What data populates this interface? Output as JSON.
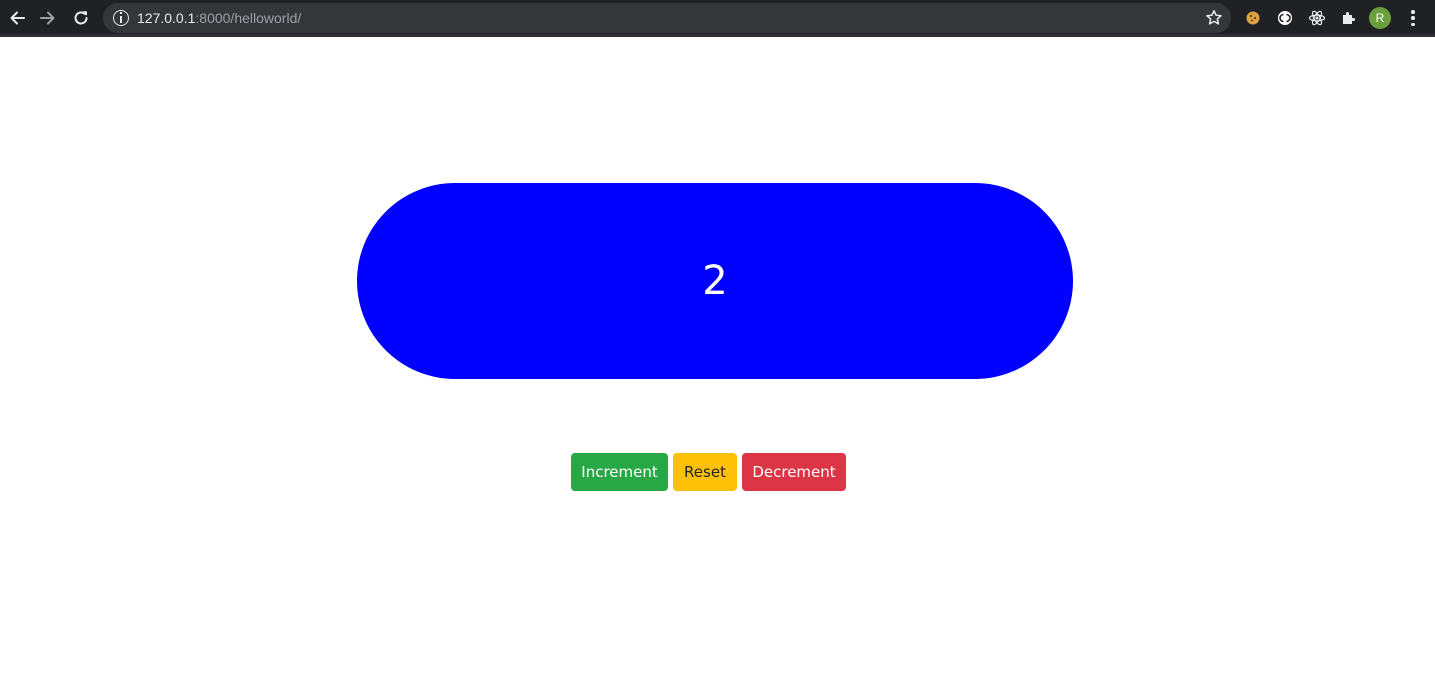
{
  "browser": {
    "url_host": "127.0.0.1",
    "url_rest": ":8000/helloworld/",
    "avatar_letter": "R",
    "icons": [
      "back-icon",
      "forward-icon",
      "reload-icon",
      "info-icon",
      "star-icon",
      "cookie-extension-icon",
      "extension-icon",
      "react-devtools-icon",
      "puzzle-extensions-icon",
      "avatar",
      "menu-icon"
    ]
  },
  "counter": {
    "value": "2",
    "background_color": "#0000ff"
  },
  "buttons": {
    "increment_label": "Increment",
    "reset_label": "Reset",
    "decrement_label": "Decrement",
    "colors": {
      "increment": "#28a745",
      "reset": "#ffc107",
      "decrement": "#dc3545"
    }
  }
}
